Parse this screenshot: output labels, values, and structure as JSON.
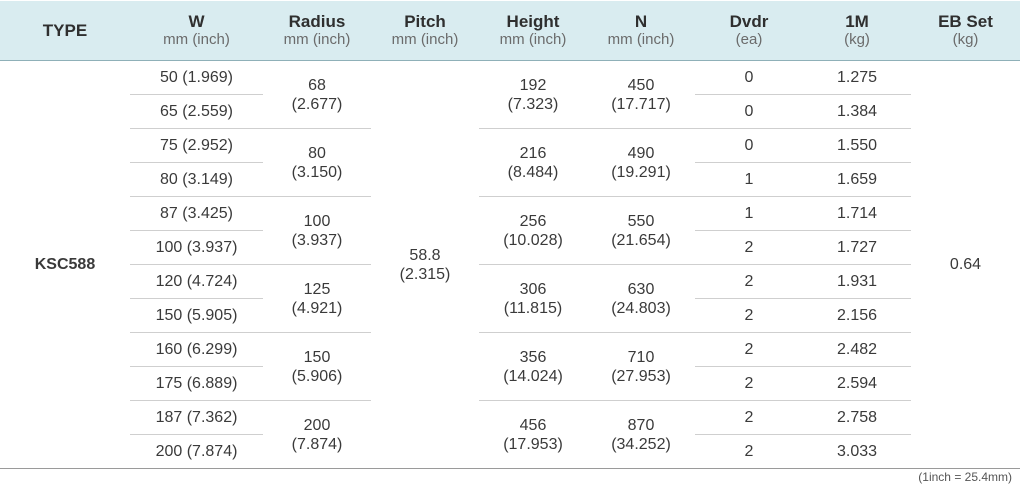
{
  "headers": [
    {
      "main": "TYPE",
      "unit": ""
    },
    {
      "main": "W",
      "unit": "mm (inch)"
    },
    {
      "main": "Radius",
      "unit": "mm (inch)"
    },
    {
      "main": "Pitch",
      "unit": "mm (inch)"
    },
    {
      "main": "Height",
      "unit": "mm (inch)"
    },
    {
      "main": "N",
      "unit": "mm (inch)"
    },
    {
      "main": "Dvdr",
      "unit": "(ea)"
    },
    {
      "main": "1M",
      "unit": "(kg)"
    },
    {
      "main": "EB Set",
      "unit": "(kg)"
    }
  ],
  "type": "KSC588",
  "pitch": {
    "mm": "58.8",
    "inch": "(2.315)"
  },
  "eb_set": "0.64",
  "rows": [
    {
      "w": "50 (1.969)",
      "dvdr": "0",
      "m1": "1.275"
    },
    {
      "w": "65 (2.559)",
      "dvdr": "0",
      "m1": "1.384"
    },
    {
      "w": "75 (2.952)",
      "dvdr": "0",
      "m1": "1.550"
    },
    {
      "w": "80 (3.149)",
      "dvdr": "1",
      "m1": "1.659"
    },
    {
      "w": "87 (3.425)",
      "dvdr": "1",
      "m1": "1.714"
    },
    {
      "w": "100 (3.937)",
      "dvdr": "2",
      "m1": "1.727"
    },
    {
      "w": "120 (4.724)",
      "dvdr": "2",
      "m1": "1.931"
    },
    {
      "w": "150 (5.905)",
      "dvdr": "2",
      "m1": "2.156"
    },
    {
      "w": "160 (6.299)",
      "dvdr": "2",
      "m1": "2.482"
    },
    {
      "w": "175 (6.889)",
      "dvdr": "2",
      "m1": "2.594"
    },
    {
      "w": "187 (7.362)",
      "dvdr": "2",
      "m1": "2.758"
    },
    {
      "w": "200 (7.874)",
      "dvdr": "2",
      "m1": "3.033"
    }
  ],
  "groups": [
    {
      "radius_mm": "68",
      "radius_in": "(2.677)",
      "height_mm": "192",
      "height_in": "(7.323)",
      "n_mm": "450",
      "n_in": "(17.717)"
    },
    {
      "radius_mm": "80",
      "radius_in": "(3.150)",
      "height_mm": "216",
      "height_in": "(8.484)",
      "n_mm": "490",
      "n_in": "(19.291)"
    },
    {
      "radius_mm": "100",
      "radius_in": "(3.937)",
      "height_mm": "256",
      "height_in": "(10.028)",
      "n_mm": "550",
      "n_in": "(21.654)"
    },
    {
      "radius_mm": "125",
      "radius_in": "(4.921)",
      "height_mm": "306",
      "height_in": "(11.815)",
      "n_mm": "630",
      "n_in": "(24.803)"
    },
    {
      "radius_mm": "150",
      "radius_in": "(5.906)",
      "height_mm": "356",
      "height_in": "(14.024)",
      "n_mm": "710",
      "n_in": "(27.953)"
    },
    {
      "radius_mm": "200",
      "radius_in": "(7.874)",
      "height_mm": "456",
      "height_in": "(17.953)",
      "n_mm": "870",
      "n_in": "(34.252)"
    }
  ],
  "footnote": "(1inch = 25.4mm)"
}
